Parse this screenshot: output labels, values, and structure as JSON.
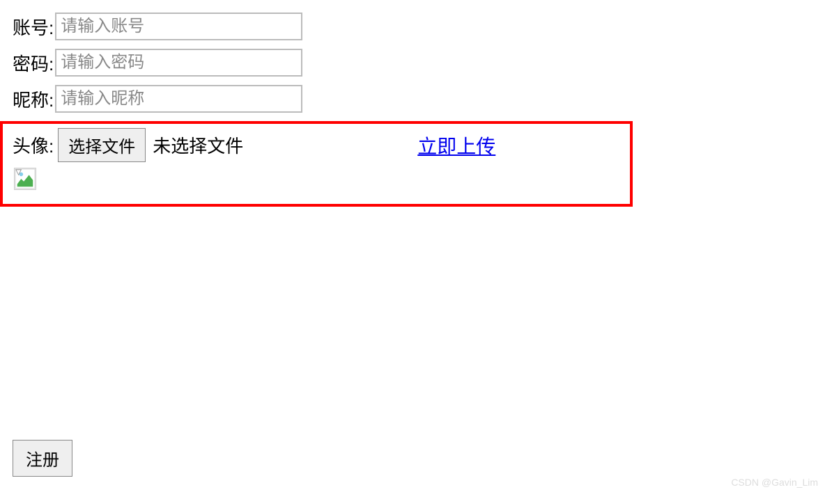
{
  "form": {
    "account": {
      "label": "账号:",
      "placeholder": "请输入账号"
    },
    "password": {
      "label": "密码:",
      "placeholder": "请输入密码"
    },
    "nickname": {
      "label": "昵称:",
      "placeholder": "请输入昵称"
    },
    "avatar": {
      "label": "头像:",
      "file_button": "选择文件",
      "file_status": "未选择文件",
      "upload_link": "立即上传"
    },
    "submit": "注册"
  },
  "watermark": "CSDN @Gavin_Lim"
}
